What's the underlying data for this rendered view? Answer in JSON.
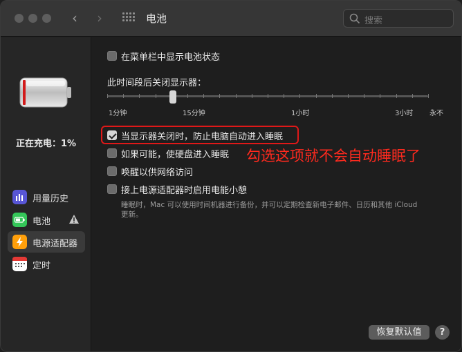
{
  "window": {
    "title": "电池"
  },
  "search": {
    "placeholder": "搜索"
  },
  "sidebar": {
    "charge_status": "正在充电：1%",
    "items": [
      {
        "label": "用量历史",
        "icon": "bar-chart-icon",
        "color": "#5856d6"
      },
      {
        "label": "电池",
        "icon": "battery-icon",
        "color": "#34c759",
        "warning": true
      },
      {
        "label": "电源适配器",
        "icon": "bolt-icon",
        "color": "#ff9f0a",
        "selected": true
      },
      {
        "label": "定时",
        "icon": "calendar-icon",
        "color": "#ffffff"
      }
    ]
  },
  "main": {
    "show_battery_status": {
      "label": "在菜单栏中显示电池状态",
      "checked": false
    },
    "display_off": {
      "label": "此时间段后关闭显示器：",
      "ticks": [
        "1分钟",
        "15分钟",
        "1小时",
        "3小时",
        "永不"
      ],
      "value": "15分钟"
    },
    "prevent_sleep": {
      "label": "当显示器关闭时，防止电脑自动进入睡眠",
      "checked": true
    },
    "disk_sleep": {
      "label": "如果可能，使硬盘进入睡眠",
      "checked": false
    },
    "wake_network": {
      "label": "唤醒以供网络访问",
      "checked": false
    },
    "power_nap": {
      "label": "接上电源适配器时启用电能小憩",
      "checked": false,
      "desc_line1": "睡眠时，Mac 可以使用时间机器进行备份，并可以定期检查新电子邮件、日历和其他 iCloud",
      "desc_line2": "更新。"
    },
    "annotation": "勾选这项就不会自动睡眠了",
    "annotation_color": "#ff2a1e",
    "restore_label": "恢复默认值",
    "help_label": "?"
  }
}
